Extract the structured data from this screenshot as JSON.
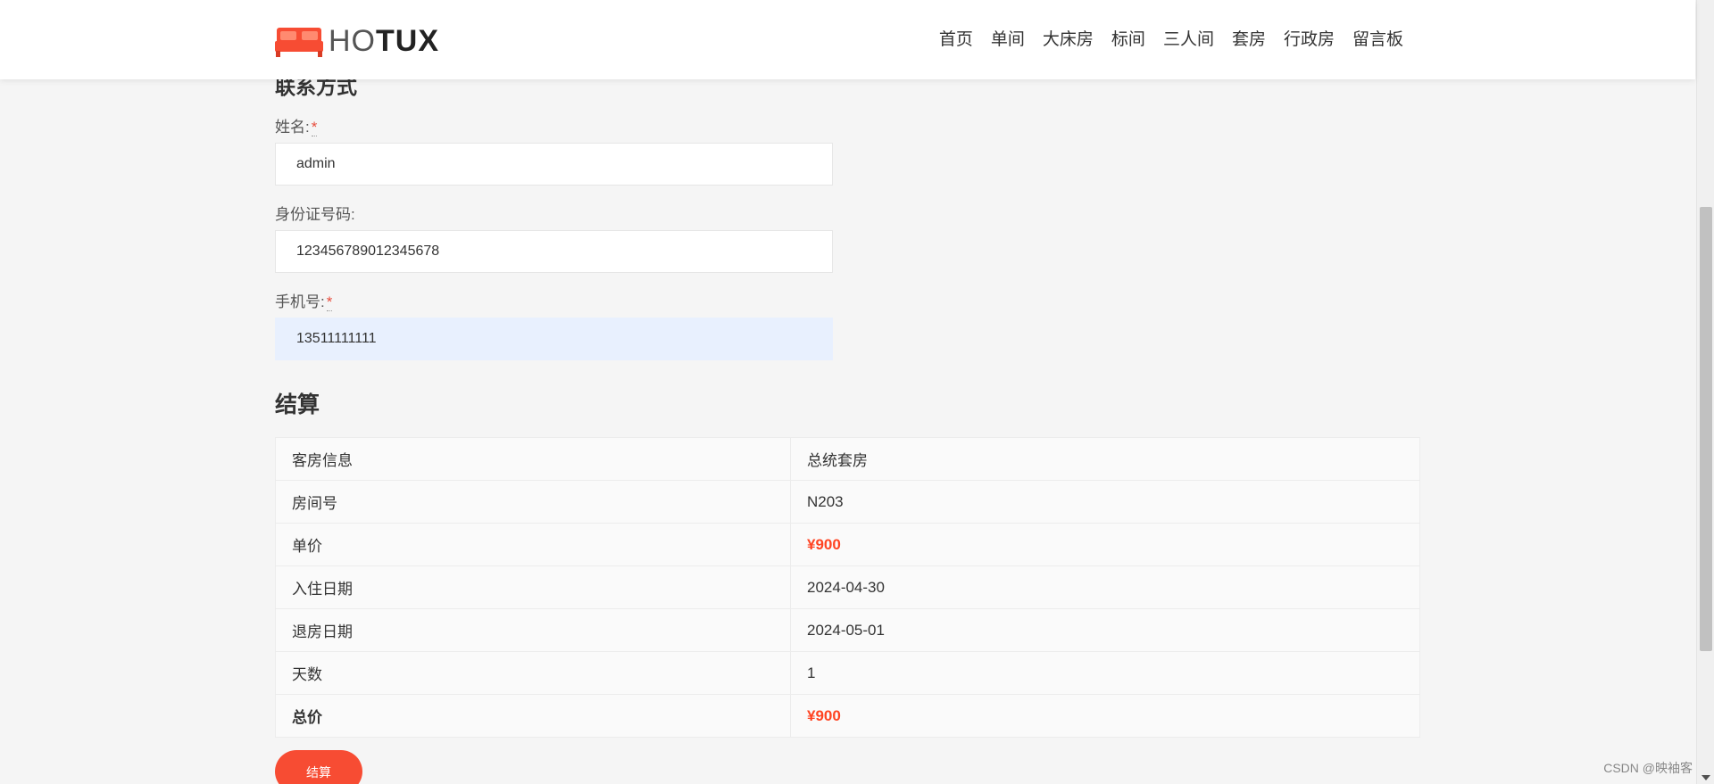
{
  "header": {
    "logo_text_thin": "HO",
    "logo_text_bold": "TUX",
    "nav": [
      "首页",
      "单间",
      "大床房",
      "标间",
      "三人间",
      "套房",
      "行政房",
      "留言板"
    ]
  },
  "contact": {
    "title_partial": "联系方式",
    "name_label": "姓名:",
    "name_required": "*",
    "name_value": "admin",
    "id_label": "身份证号码:",
    "id_value": "123456789012345678",
    "phone_label": "手机号:",
    "phone_required": "*",
    "phone_value": "13511111111"
  },
  "checkout": {
    "title": "结算",
    "rows": [
      {
        "label": "客房信息",
        "value": "总统套房"
      },
      {
        "label": "房间号",
        "value": "N203"
      },
      {
        "label": "单价",
        "value": "¥900"
      },
      {
        "label": "入住日期",
        "value": "2024-04-30"
      },
      {
        "label": "退房日期",
        "value": "2024-05-01"
      },
      {
        "label": "天数",
        "value": "1"
      },
      {
        "label": "总价",
        "value": "¥900"
      }
    ],
    "submit_label": "结算"
  },
  "watermark": "CSDN @映袖客",
  "colors": {
    "accent": "#f74c33",
    "price": "#ff4422",
    "autofill": "#e8f0fe"
  }
}
